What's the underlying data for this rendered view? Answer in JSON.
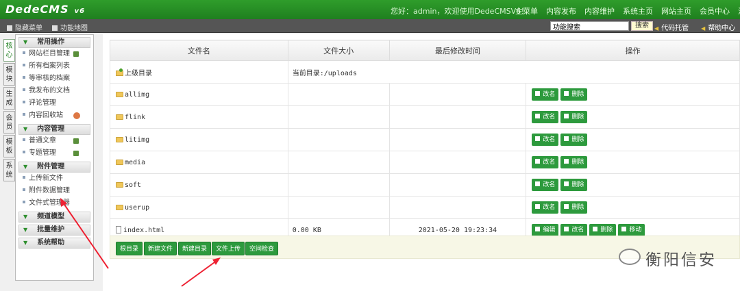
{
  "header": {
    "logo": "DedeCMS",
    "logo_version": "v6",
    "welcome": "您好：admin，欢迎使用DedeCMSV6！",
    "nav": [
      "主菜单",
      "内容发布",
      "内容维护",
      "系统主页",
      "网站主页",
      "会员中心",
      "注销"
    ]
  },
  "subbar": {
    "left": [
      "隐藏菜单",
      "功能地图"
    ],
    "search_value": "功能搜索",
    "search_button": "搜索",
    "right": [
      "代码托管",
      "帮助中心"
    ]
  },
  "vtabs": [
    "核心",
    "模块",
    "生成",
    "会员",
    "模板",
    "系统"
  ],
  "sidebar": {
    "groups": [
      {
        "title": "常用操作",
        "items": [
          "网站栏目管理",
          "所有档案列表",
          "等审核的档案",
          "我发布的文档",
          "评论管理",
          "内容回收站"
        ]
      },
      {
        "title": "内容管理",
        "items": [
          "普通文章",
          "专题管理"
        ]
      },
      {
        "title": "附件管理",
        "items": [
          "上传新文件",
          "附件数据管理",
          "文件式管理器"
        ]
      },
      {
        "title": "频道模型",
        "items": []
      },
      {
        "title": "批量维护",
        "items": []
      },
      {
        "title": "系统帮助",
        "items": []
      }
    ]
  },
  "table": {
    "headers": [
      "文件名",
      "文件大小",
      "最后修改时间",
      "操作"
    ],
    "parent": {
      "name": "上级目录",
      "current": "当前目录:/uploads"
    },
    "rows": [
      {
        "name": "allimg",
        "size": "",
        "time": "",
        "type": "folder"
      },
      {
        "name": "flink",
        "size": "",
        "time": "",
        "type": "folder"
      },
      {
        "name": "litimg",
        "size": "",
        "time": "",
        "type": "folder"
      },
      {
        "name": "media",
        "size": "",
        "time": "",
        "type": "folder"
      },
      {
        "name": "soft",
        "size": "",
        "time": "",
        "type": "folder"
      },
      {
        "name": "userup",
        "size": "",
        "time": "",
        "type": "folder"
      },
      {
        "name": "index.html",
        "size": "0.00 KB",
        "time": "2021-05-20 19:23:34",
        "type": "file"
      }
    ],
    "ops": {
      "edit": "编辑",
      "rename": "改名",
      "delete": "删除",
      "move": "移动"
    }
  },
  "bottom_buttons": [
    "根目录",
    "新建文件",
    "新建目录",
    "文件上传",
    "空间检查"
  ],
  "watermark": "衡阳信安"
}
